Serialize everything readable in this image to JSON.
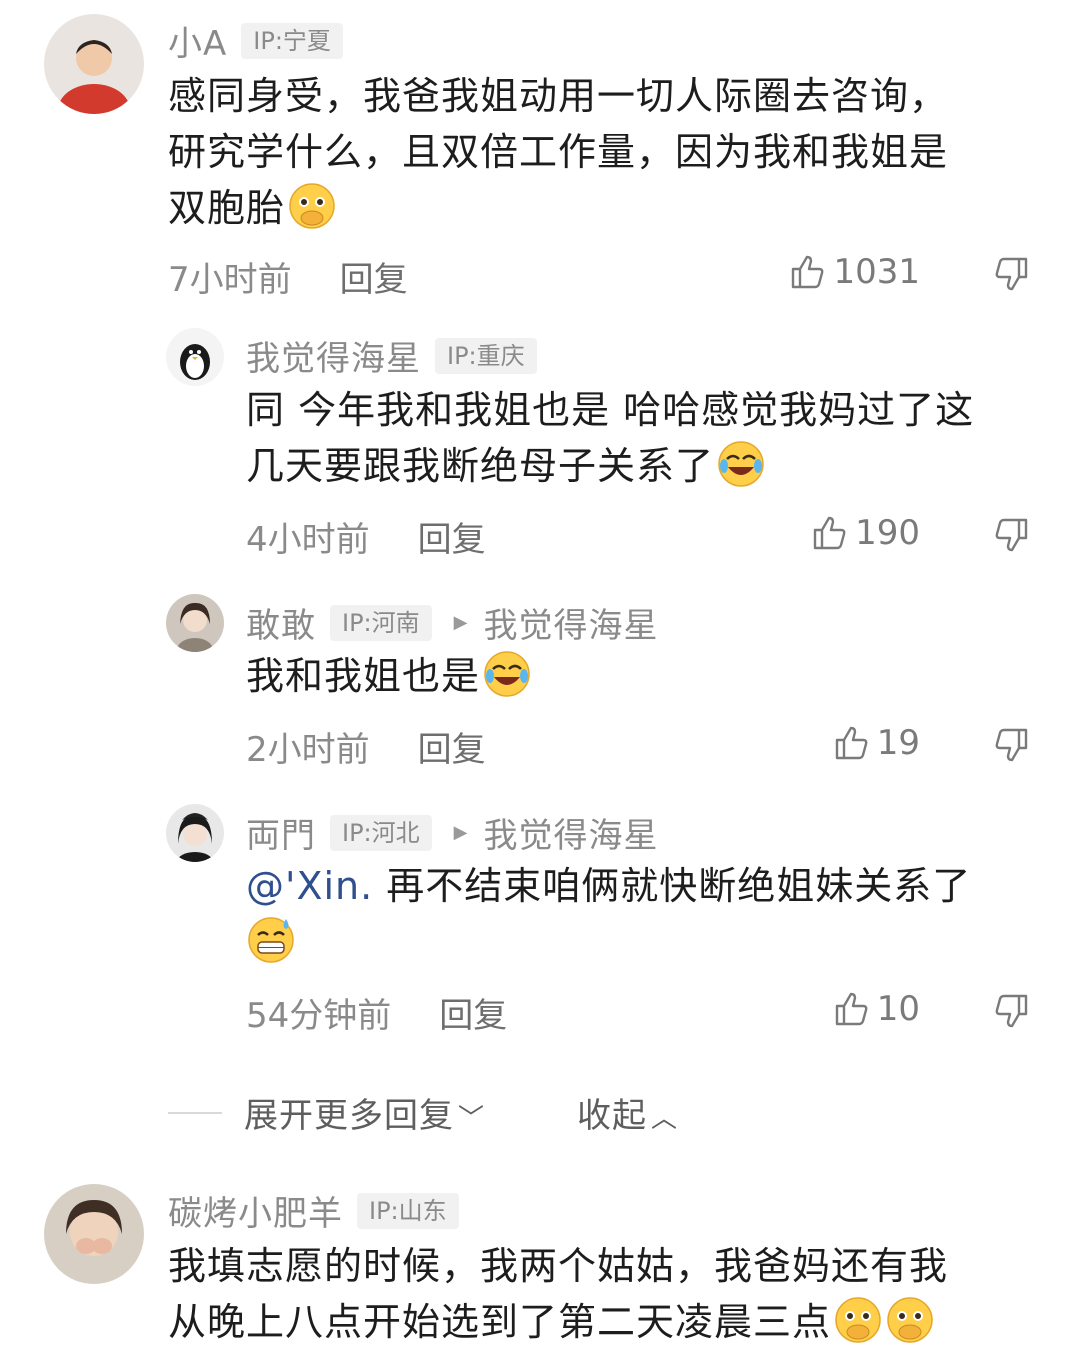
{
  "comments": [
    {
      "username": "小A",
      "ip": "IP:宁夏",
      "lines": [
        "感同身受，我爸我姐动用一切人际圈去咨询，",
        "研究学什么，且双倍工作量，因为我和我姐是",
        "双胞胎"
      ],
      "emoji": "shy-face-emoji",
      "time": "7小时前",
      "reply": "回复",
      "likes": "1031"
    },
    {
      "username": "我觉得海星",
      "ip": "IP:重庆",
      "lines": [
        "同 今年我和我姐也是 哈哈感觉我妈过了这",
        "几天要跟我断绝母子关系了"
      ],
      "emoji": "crying-laughing-emoji",
      "time": "4小时前",
      "reply": "回复",
      "likes": "190"
    },
    {
      "username": "敢敢",
      "ip": "IP:河南",
      "reply_to": "我觉得海星",
      "lines": [
        "我和我姐也是"
      ],
      "emoji": "crying-laughing-emoji",
      "time": "2小时前",
      "reply": "回复",
      "likes": "19"
    },
    {
      "username": "両門",
      "ip": "IP:河北",
      "reply_to": "我觉得海星",
      "mention": "@'Xin.",
      "lines": [
        " 再不结束咱俩就快断绝姐妹关系了"
      ],
      "emoji": "sweat-grin-emoji",
      "time": "54分钟前",
      "reply": "回复",
      "likes": "10"
    },
    {
      "username": "碳烤小肥羊",
      "ip": "IP:山东",
      "lines": [
        "我填志愿的时候，我两个姑姑，我爸妈还有我",
        "从晚上八点开始选到了第二天凌晨三点"
      ],
      "emoji": "shy-face-emoji"
    }
  ],
  "expand": {
    "more_label": "展开更多回复",
    "collapse_label": "收起"
  },
  "icons": {
    "like": "thumbs-up-icon",
    "dislike": "thumbs-down-icon",
    "expand": "chevron-down-icon",
    "collapse": "chevron-up-icon"
  }
}
